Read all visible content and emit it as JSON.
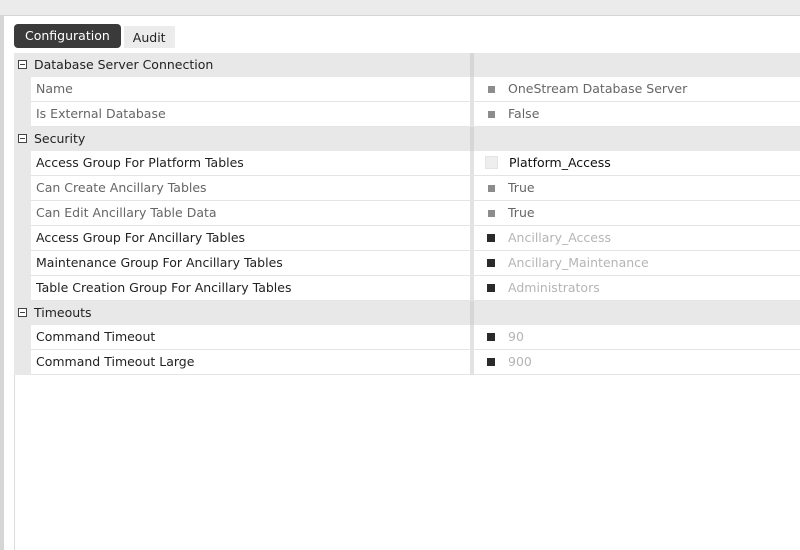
{
  "tabs": [
    {
      "label": "Configuration",
      "active": true
    },
    {
      "label": "Audit",
      "active": false
    }
  ],
  "sections": [
    {
      "title": "Database Server Connection",
      "properties": [
        {
          "name": "Name",
          "value": "OneStream Database Server"
        },
        {
          "name": "Is External Database",
          "value": "False"
        }
      ]
    },
    {
      "title": "Security",
      "properties": [
        {
          "name": "Access Group For Platform Tables",
          "value": "Platform_Access"
        },
        {
          "name": "Can Create Ancillary Tables",
          "value": "True"
        },
        {
          "name": "Can Edit Ancillary Table Data",
          "value": "True"
        },
        {
          "name": "Access Group For Ancillary Tables",
          "value": "Ancillary_Access"
        },
        {
          "name": "Maintenance Group For Ancillary Tables",
          "value": "Ancillary_Maintenance"
        },
        {
          "name": "Table Creation Group For Ancillary Tables",
          "value": "Administrators"
        }
      ]
    },
    {
      "title": "Timeouts",
      "properties": [
        {
          "name": "Command Timeout",
          "value": "90"
        },
        {
          "name": "Command Timeout Large",
          "value": "900"
        }
      ]
    }
  ],
  "colors": {
    "active_tab_bg": "#3a3a3a",
    "category_bg": "#e8e8e8",
    "faded_value": "#b5b5b5"
  }
}
